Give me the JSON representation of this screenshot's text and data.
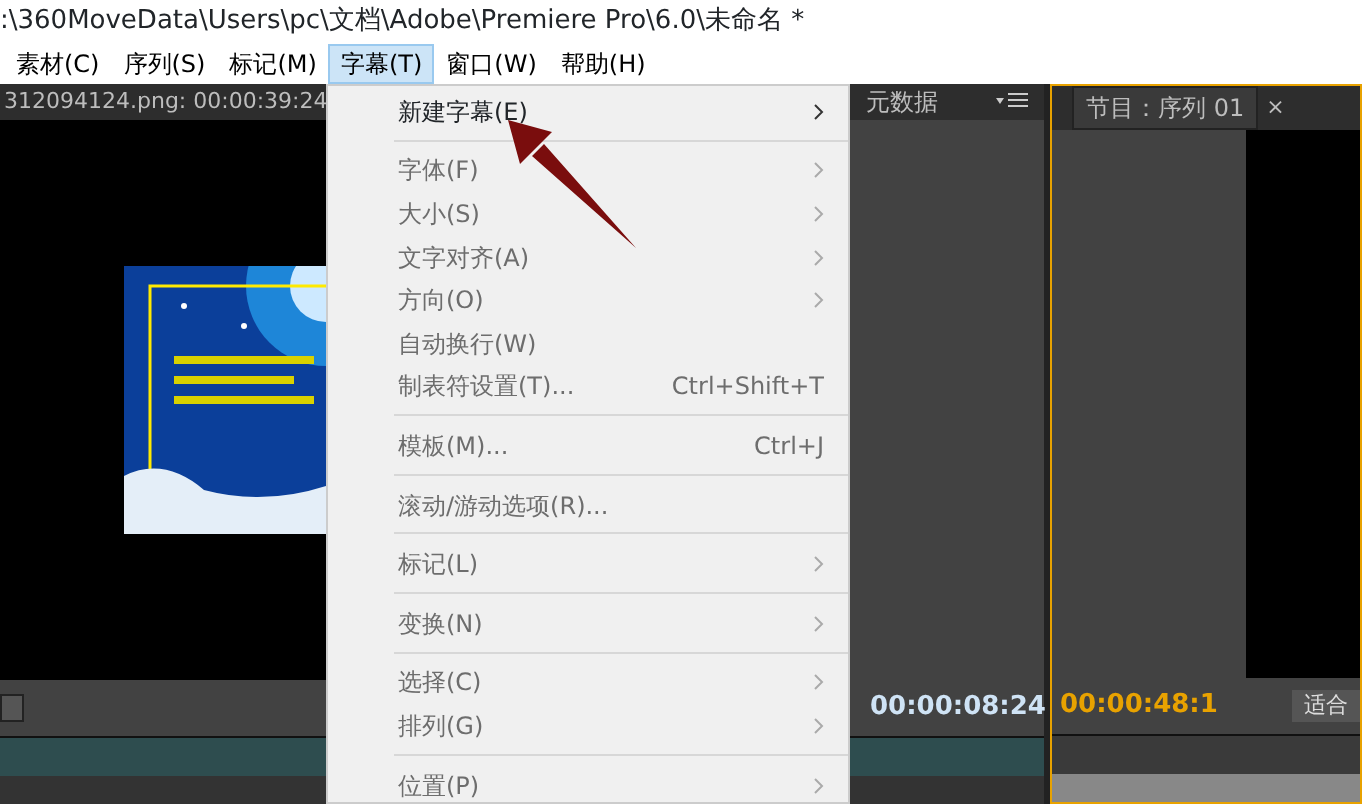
{
  "window": {
    "title": ":\\360MoveData\\Users\\pc\\文档\\Adobe\\Premiere Pro\\6.0\\未命名 *"
  },
  "menu_bar": [
    {
      "label": "素材(C)",
      "selected": false
    },
    {
      "label": "序列(S)",
      "selected": false
    },
    {
      "label": "标记(M)",
      "selected": false
    },
    {
      "label": "字幕(T)",
      "selected": true
    },
    {
      "label": "窗口(W)",
      "selected": false
    },
    {
      "label": "帮助(H)",
      "selected": false
    }
  ],
  "menu": [
    {
      "label": "新建字幕(E)",
      "disabled": false,
      "submenu": true
    },
    {
      "kind": "separator"
    },
    {
      "label": "字体(F)",
      "disabled": true,
      "submenu": true
    },
    {
      "label": "大小(S)",
      "disabled": true,
      "submenu": true
    },
    {
      "label": "文字对齐(A)",
      "disabled": true,
      "submenu": true
    },
    {
      "label": "方向(O)",
      "disabled": true,
      "submenu": true
    },
    {
      "label": "自动换行(W)",
      "disabled": true,
      "submenu": false
    },
    {
      "label": "制表符设置(T)...",
      "shortcut": "Ctrl+Shift+T",
      "disabled": true,
      "submenu": false
    },
    {
      "kind": "separator"
    },
    {
      "label": "模板(M)...",
      "shortcut": "Ctrl+J",
      "disabled": true,
      "submenu": false
    },
    {
      "kind": "separator"
    },
    {
      "label": "滚动/游动选项(R)...",
      "disabled": true,
      "submenu": false
    },
    {
      "kind": "separator"
    },
    {
      "label": "标记(L)",
      "disabled": true,
      "submenu": true
    },
    {
      "kind": "separator"
    },
    {
      "label": "变换(N)",
      "disabled": true,
      "submenu": true
    },
    {
      "kind": "separator"
    },
    {
      "label": "选择(C)",
      "disabled": true,
      "submenu": true
    },
    {
      "label": "排列(G)",
      "disabled": true,
      "submenu": true
    },
    {
      "kind": "separator"
    },
    {
      "label": "位置(P)",
      "disabled": true,
      "submenu": true
    }
  ],
  "source_panel": {
    "tab": "312094124.png: 00:00:39:24"
  },
  "metadata_panel": {
    "tab": "元数据",
    "timecode": "00:00:08:24"
  },
  "program_panel": {
    "tab": "节目：序列 01",
    "close": "×",
    "timecode": "00:00:48:1",
    "zoom": "适合"
  }
}
